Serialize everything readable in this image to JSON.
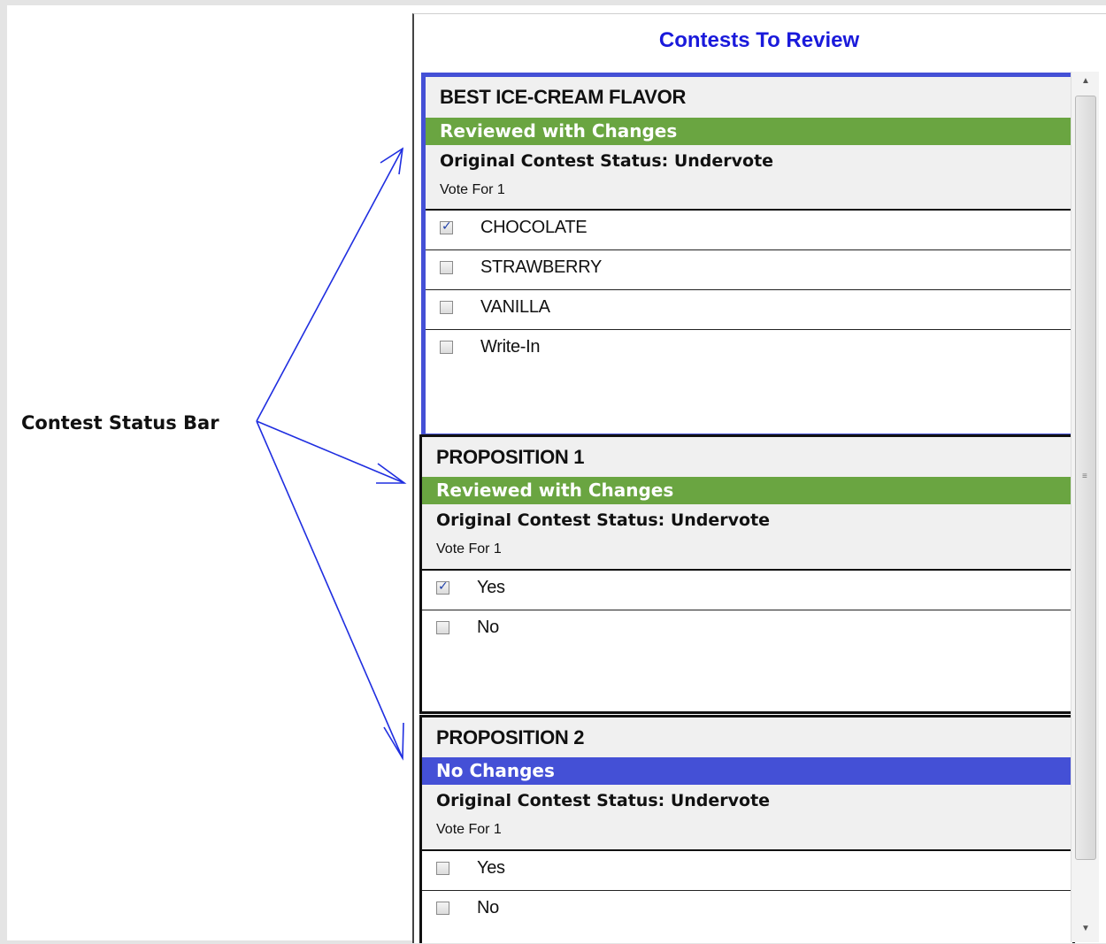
{
  "annotation": {
    "label": "Contest Status Bar"
  },
  "panel": {
    "title": "Contests To Review"
  },
  "colors": {
    "reviewed_with_changes": "#6aa541",
    "no_changes": "#4450d6",
    "title": "#1a1adb",
    "arrow": "#1f2ee0"
  },
  "contests": [
    {
      "title": "BEST ICE-CREAM FLAVOR",
      "status": "Reviewed with Changes",
      "status_color": "#6aa541",
      "original_status": "Original Contest Status: Undervote",
      "vote_for": "Vote For 1",
      "options": [
        {
          "label": "CHOCOLATE",
          "checked": true
        },
        {
          "label": "STRAWBERRY",
          "checked": false
        },
        {
          "label": "VANILLA",
          "checked": false
        },
        {
          "label": "Write-In",
          "checked": false
        }
      ]
    },
    {
      "title": "PROPOSITION 1",
      "status": "Reviewed with Changes",
      "status_color": "#6aa541",
      "original_status": "Original Contest Status: Undervote",
      "vote_for": "Vote For 1",
      "options": [
        {
          "label": "Yes",
          "checked": true
        },
        {
          "label": "No",
          "checked": false
        }
      ]
    },
    {
      "title": "PROPOSITION 2",
      "status": "No Changes",
      "status_color": "#4450d6",
      "original_status": "Original Contest Status: Undervote",
      "vote_for": "Vote For 1",
      "options": [
        {
          "label": "Yes",
          "checked": false
        },
        {
          "label": "No",
          "checked": false
        }
      ]
    }
  ],
  "scrollbar": {
    "up_icon": "triangle-up",
    "down_icon": "triangle-down",
    "grip_icon": "grip-lines"
  }
}
